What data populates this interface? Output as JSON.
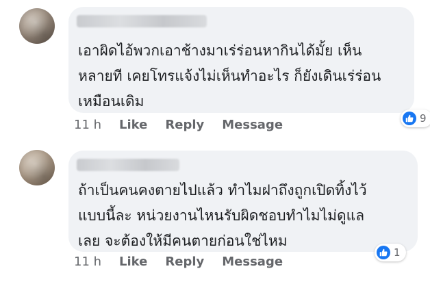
{
  "comments": [
    {
      "text": "เอาผิดไอ้พวกเอาช้างมาเร่ร่อนหากินได้มั้ย เห็น\nหลายที เคยโทรแจ้งไม่เห็นทำอะไร ก็ยังเดินเร่ร่อน\nเหมือนเดิม",
      "time": "11 h",
      "like_label": "Like",
      "reply_label": "Reply",
      "message_label": "Message",
      "reaction_count": "9",
      "reaction_icon": "like-thumb-icon"
    },
    {
      "text": "ถ้าเป็นคนคงตายไปแล้ว ทำไมฝาถึงถูกเปิดทิ้งไว้\nแบบนี้ละ หน่วยงานไหนรับผิดชอบทำไมไม่ดูแล\nเลย จะต้องให้มีคนตายก่อนใช่ไหม",
      "time": "11 h",
      "like_label": "Like",
      "reply_label": "Reply",
      "message_label": "Message",
      "reaction_count": "1",
      "reaction_icon": "like-thumb-icon"
    }
  ],
  "colors": {
    "bubble": "#f0f2f5",
    "text": "#1c1e21",
    "meta": "#65676b",
    "like_blue": "#1877f2"
  }
}
